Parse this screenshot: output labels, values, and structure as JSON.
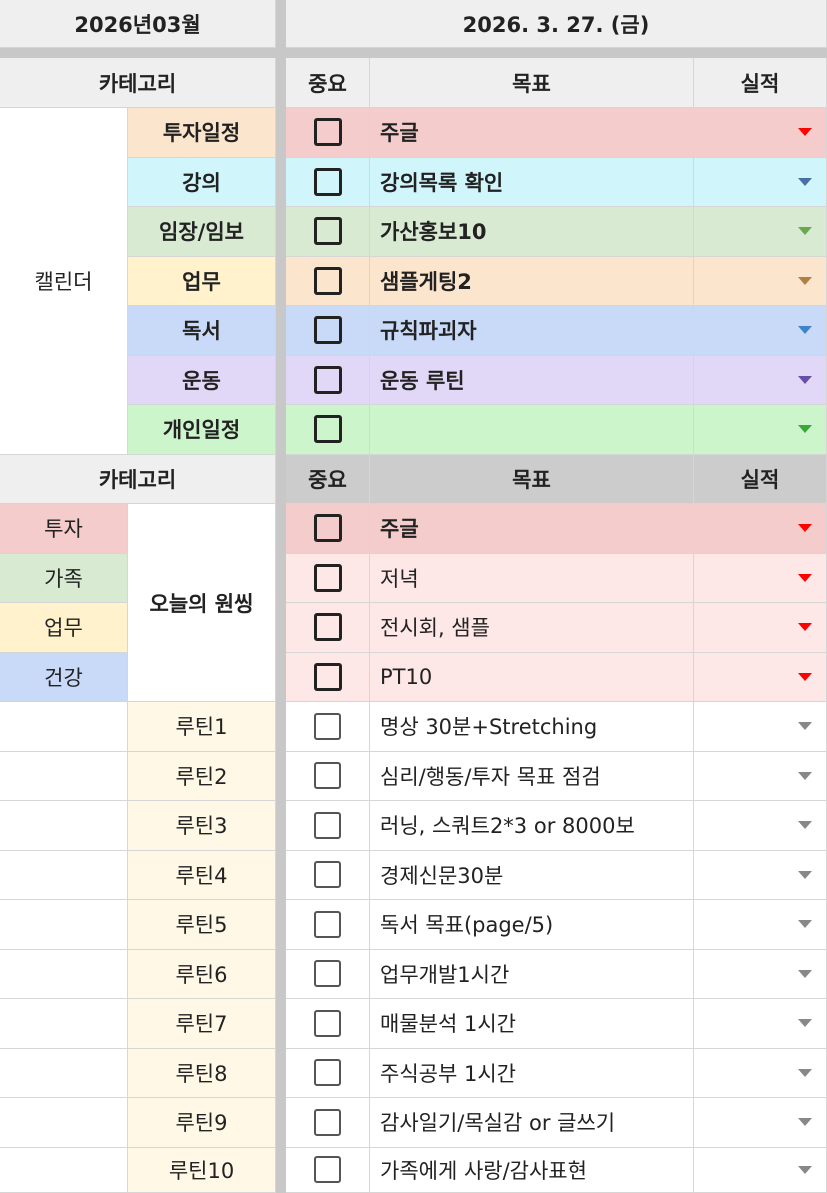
{
  "header": {
    "month": "2026년03월",
    "date": "2026. 3. 27. (금)"
  },
  "section1": {
    "col_category": "카테고리",
    "col_importance": "중요",
    "col_goal": "목표",
    "col_result": "실적",
    "group_label": "캘린더",
    "rows": [
      {
        "category": "투자일정",
        "goal": "주글",
        "cat_color": "#fce5cd",
        "row_color": "#f4cccc",
        "arrow_color": "#ff0000"
      },
      {
        "category": "강의",
        "goal": "강의목록 확인",
        "cat_color": "#d0f5fa",
        "row_color": "#d0f5fa",
        "arrow_color": "#4a6fa5"
      },
      {
        "category": "임장/임보",
        "goal": "가산홍보10",
        "cat_color": "#d9ead3",
        "row_color": "#d9ead3",
        "arrow_color": "#6aa84f"
      },
      {
        "category": "업무",
        "goal": "샘플게팅2",
        "cat_color": "#fff2cc",
        "row_color": "#fce5cd",
        "arrow_color": "#b08040"
      },
      {
        "category": "독서",
        "goal": "규칙파괴자",
        "cat_color": "#c9daf8",
        "row_color": "#c9daf8",
        "arrow_color": "#3d85c6"
      },
      {
        "category": "운동",
        "goal": "운동 루틴",
        "cat_color": "#e1d8f8",
        "row_color": "#e1d8f8",
        "arrow_color": "#674ea7"
      },
      {
        "category": "개인일정",
        "goal": "",
        "cat_color": "#ccf5cc",
        "row_color": "#ccf5cc",
        "arrow_color": "#38a838"
      }
    ]
  },
  "section2": {
    "col_category": "카테고리",
    "col_importance": "중요",
    "col_goal": "목표",
    "col_result": "실적",
    "group_label": "오늘의 원씽",
    "categories": [
      {
        "label": "투자",
        "color": "#f4cccc"
      },
      {
        "label": "가족",
        "color": "#d9ead3"
      },
      {
        "label": "업무",
        "color": "#fff2cc"
      },
      {
        "label": "건강",
        "color": "#c9daf8"
      }
    ],
    "rows": [
      {
        "goal": "주글",
        "row_color": "#f4cccc"
      },
      {
        "goal": "저녁",
        "row_color": "#fde7e7"
      },
      {
        "goal": "전시회, 샘플",
        "row_color": "#fde7e7"
      },
      {
        "goal": "PT10",
        "row_color": "#fde7e7"
      }
    ]
  },
  "routines": [
    {
      "label": "루틴1",
      "goal": "명상 30분+Stretching"
    },
    {
      "label": "루틴2",
      "goal": "심리/행동/투자 목표 점검"
    },
    {
      "label": "루틴3",
      "goal": "러닝, 스쿼트2*3 or 8000보"
    },
    {
      "label": "루틴4",
      "goal": "경제신문30분"
    },
    {
      "label": "루틴5",
      "goal": "독서 목표(page/5)"
    },
    {
      "label": "루틴6",
      "goal": "업무개발1시간"
    },
    {
      "label": "루틴7",
      "goal": "매물분석 1시간"
    },
    {
      "label": "루틴8",
      "goal": "주식공부 1시간"
    },
    {
      "label": "루틴9",
      "goal": "감사일기/목실감 or 글쓰기"
    },
    {
      "label": "루틴10",
      "goal": "가족에게 사랑/감사표현"
    }
  ],
  "colors": {
    "routine_label_bg": "#fff8e6",
    "header_bg": "#efefef",
    "header2_bg": "#cccccc",
    "pink_arrow": "#ff0000",
    "gray_arrow": "#888888"
  }
}
